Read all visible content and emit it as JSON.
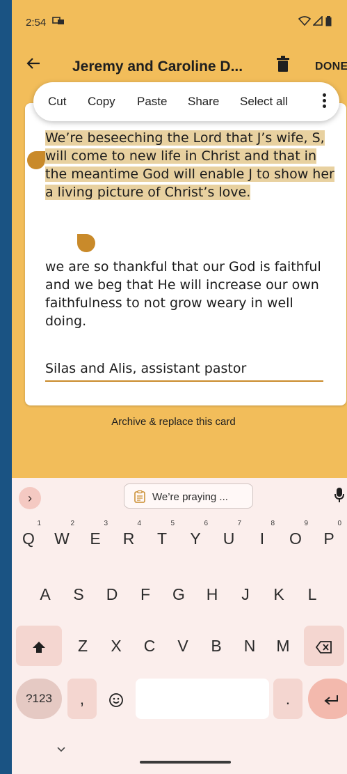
{
  "status": {
    "time": "2:54"
  },
  "appbar": {
    "title": "Jeremy and Caroline D...",
    "done": "DONE"
  },
  "context_menu": {
    "items": [
      "Cut",
      "Copy",
      "Paste",
      "Share",
      "Select all"
    ]
  },
  "note": {
    "selected_text": "We’re beseeching the Lord that J’s wife, S, will come to new life in Christ and that in the meantime God will enable J to show her a living picture of Christ’s love.",
    "paragraph2": "we are so thankful that our God is faithful and we beg that He will increase our own faithfulness to not grow weary in well doing.",
    "signature": "Silas and Alis, assistant pastor"
  },
  "archive_label": "Archive & replace this card",
  "keyboard": {
    "suggestion": "We’re praying ...",
    "row1": [
      "Q",
      "W",
      "E",
      "R",
      "T",
      "Y",
      "U",
      "I",
      "O",
      "P"
    ],
    "row1_hints": [
      "1",
      "2",
      "3",
      "4",
      "5",
      "6",
      "7",
      "8",
      "9",
      "0"
    ],
    "row2": [
      "A",
      "S",
      "D",
      "F",
      "G",
      "H",
      "J",
      "K",
      "L"
    ],
    "row3": [
      "Z",
      "X",
      "C",
      "V",
      "B",
      "N",
      "M"
    ],
    "symbols_key": "?123",
    "comma": ",",
    "period": "."
  },
  "colors": {
    "background": "#f2bd5a",
    "accent": "#c98a2a",
    "selection": "#e8d1a0",
    "keyboard": "#fbeeec"
  }
}
